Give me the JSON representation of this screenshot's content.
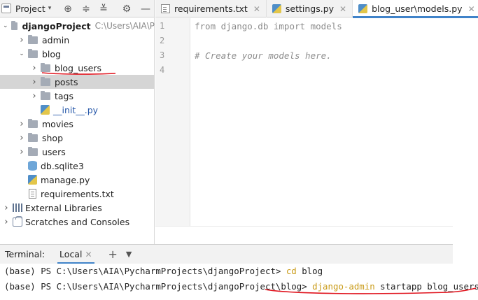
{
  "project_panel": {
    "title": "Project",
    "toolbar": [
      "locate-icon",
      "expand-all-icon",
      "collapse-all-icon",
      "gear-icon",
      "hide-icon"
    ],
    "tree": [
      {
        "label": "djangoProject",
        "hint": "C:\\Users\\AIA\\P",
        "depth": 0,
        "expanded": true,
        "type": "folder"
      },
      {
        "label": "admin",
        "depth": 1,
        "expanded": false,
        "type": "folder"
      },
      {
        "label": "blog",
        "depth": 1,
        "expanded": true,
        "type": "folder"
      },
      {
        "label": "blog_users",
        "depth": 2,
        "expanded": false,
        "type": "folder"
      },
      {
        "label": "posts",
        "depth": 2,
        "expanded": false,
        "type": "folder",
        "selected": true
      },
      {
        "label": "tags",
        "depth": 2,
        "expanded": false,
        "type": "folder"
      },
      {
        "label": "__init__.py",
        "depth": 2,
        "type": "py"
      },
      {
        "label": "movies",
        "depth": 1,
        "expanded": false,
        "type": "folder"
      },
      {
        "label": "shop",
        "depth": 1,
        "expanded": false,
        "type": "folder"
      },
      {
        "label": "users",
        "depth": 1,
        "expanded": false,
        "type": "folder"
      },
      {
        "label": "db.sqlite3",
        "depth": 1,
        "type": "db"
      },
      {
        "label": "manage.py",
        "depth": 1,
        "type": "py"
      },
      {
        "label": "requirements.txt",
        "depth": 1,
        "type": "txt"
      },
      {
        "label": "External Libraries",
        "depth": 0,
        "expanded": false,
        "type": "lib"
      },
      {
        "label": "Scratches and Consoles",
        "depth": 0,
        "expanded": false,
        "type": "scratch"
      }
    ]
  },
  "editor": {
    "tabs": [
      {
        "label": "requirements.txt",
        "icon": "text-file-icon",
        "active": false
      },
      {
        "label": "settings.py",
        "icon": "python-file-icon",
        "active": false
      },
      {
        "label": "blog_user\\models.py",
        "icon": "python-file-icon",
        "active": true
      }
    ],
    "lines": [
      {
        "number": "1",
        "text": "from django.db import models",
        "style": "faded"
      },
      {
        "number": "2",
        "text": "",
        "style": "plain"
      },
      {
        "number": "3",
        "text": "# Create your models here.",
        "style": "comment"
      },
      {
        "number": "4",
        "text": "",
        "style": "plain"
      }
    ]
  },
  "terminal": {
    "title": "Terminal:",
    "tab_label": "Local",
    "lines": [
      {
        "prompt": "(base) PS C:\\Users\\AIA\\PycharmProjects\\djangoProject> ",
        "command": "cd",
        "args": " blog"
      },
      {
        "prompt": "(base) PS C:\\Users\\AIA\\PycharmProjects\\djangoProject\\blog> ",
        "command": "django-admin",
        "args": " startapp blog_users"
      }
    ]
  },
  "colors": {
    "accent_blue": "#4083c9",
    "selection": "#d5d5d5",
    "command_orange": "#c99a16",
    "annotation_red": "#e0141e"
  }
}
